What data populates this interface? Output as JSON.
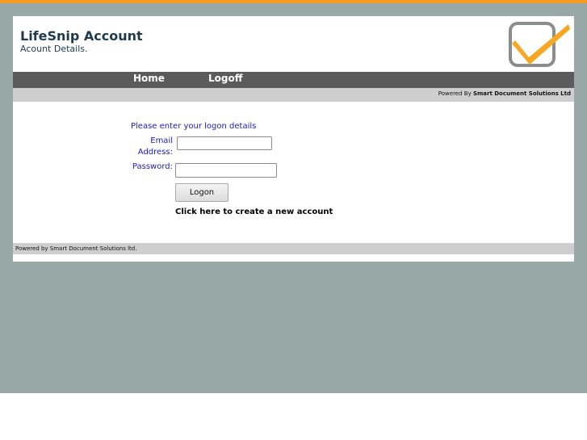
{
  "header": {
    "title": "LifeSnip Account",
    "subtitle": "Acount Details."
  },
  "nav": {
    "items": [
      {
        "label": "Home"
      },
      {
        "label": "Logoff"
      }
    ]
  },
  "powered_bar": {
    "prefix": "Powered By ",
    "company": "Smart Document Solutions Ltd"
  },
  "login": {
    "prompt": "Please enter your logon details",
    "email_label_line1": "Email",
    "email_label_line2": "Address:",
    "email_value": "",
    "password_label": "Password:",
    "password_value": "",
    "button_label": "Logon",
    "create_account_link": "Click here to create a new account"
  },
  "footer": {
    "text": "Powered by Smart Document Solutions ltd."
  },
  "colors": {
    "top_strip": "#f79a1e",
    "page_background": "#97a8a6",
    "navbar": "#5b5b5b",
    "info_bar": "#cecece",
    "label_text": "#1a1acc",
    "brand_text": "#1d3a4e",
    "logo_checkmark": "#f7a823",
    "logo_box": "#8c8c8c"
  },
  "icons": {
    "logo": "checkbox-check-icon"
  }
}
